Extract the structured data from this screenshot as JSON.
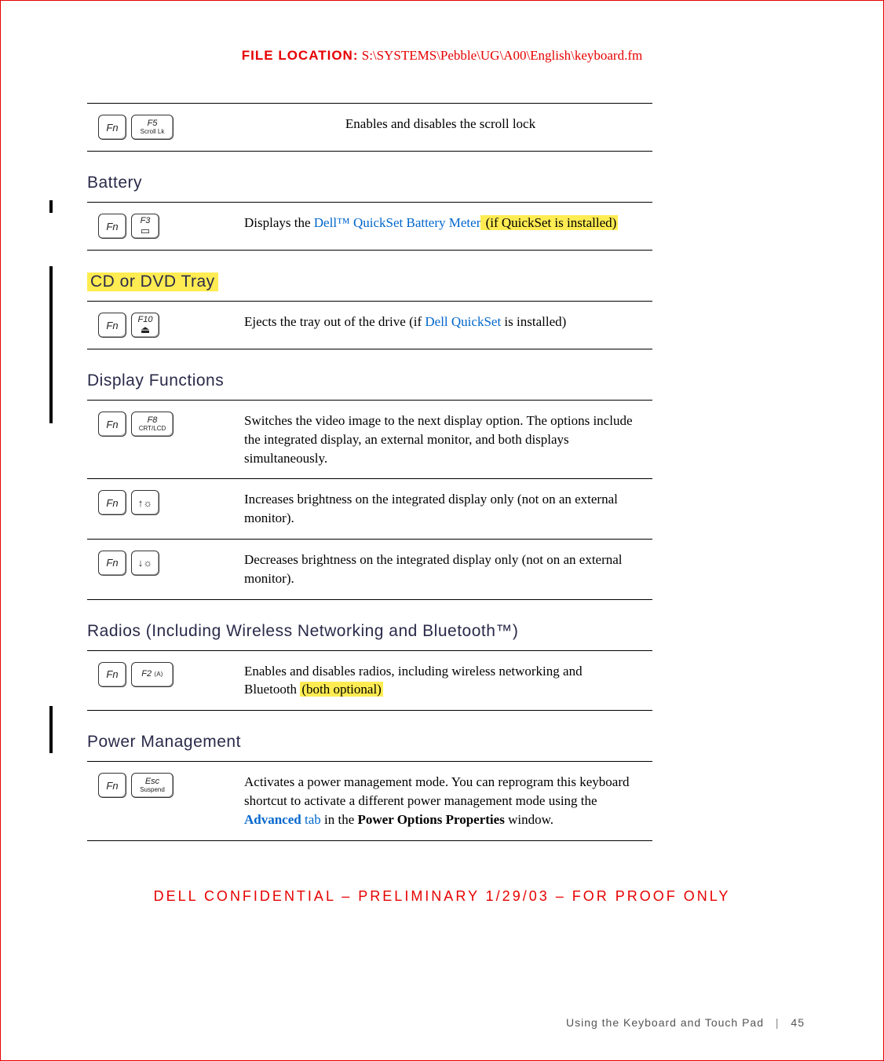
{
  "file_location": {
    "label": "FILE LOCATION:",
    "path": "S:\\SYSTEMS\\Pebble\\UG\\A00\\English\\keyboard.fm"
  },
  "sections": {
    "scroll": {
      "key1": "Fn",
      "key2_top": "F5",
      "key2_bot": "Scroll Lk",
      "desc": "Enables and disables the scroll lock"
    },
    "battery": {
      "heading": "Battery",
      "key1": "Fn",
      "key2_top": "F3",
      "desc_pre": "Displays the ",
      "desc_link": "Dell™ QuickSet Battery Meter",
      "desc_hl": " (if QuickSet is installed)"
    },
    "cd": {
      "heading": "CD or DVD Tray",
      "key1": "Fn",
      "key2_top": "F10",
      "desc_pre": "Ejects the tray out of the drive (if ",
      "desc_link": "Dell QuickSet",
      "desc_post": " is installed)"
    },
    "display": {
      "heading": "Display Functions",
      "r1_key1": "Fn",
      "r1_key2_top": "F8",
      "r1_key2_bot": "CRT/LCD",
      "r1_desc": "Switches the video image to the next display option. The options include the integrated display, an external monitor, and both displays simultaneously.",
      "r2_key1": "Fn",
      "r2_key2_icon": "↑☼",
      "r2_desc": "Increases brightness on the integrated display only (not on an external monitor).",
      "r3_key1": "Fn",
      "r3_key2_icon": "↓☼",
      "r3_desc": "Decreases brightness on the integrated display only (not on an external monitor)."
    },
    "radios": {
      "heading": "Radios (Including Wireless Networking and Bluetooth™)",
      "key1": "Fn",
      "key2_top": "F2",
      "key2_icon": "⟨A⟩",
      "desc_pre": "Enables and disables radios, including wireless networking and Bluetooth ",
      "desc_hl": "(both optional)"
    },
    "power": {
      "heading": "Power Management",
      "key1": "Fn",
      "key2_top": "Esc",
      "key2_bot": "Suspend",
      "desc_pre": "Activates a power management mode. You can reprogram this keyboard shortcut to activate a different power management mode using the ",
      "desc_link": "Advanced",
      "desc_link2": " tab",
      "desc_mid": " in the ",
      "desc_bold": "Power Options Properties",
      "desc_post": " window."
    }
  },
  "confidential": "DELL CONFIDENTIAL – PRELIMINARY 1/29/03 – FOR PROOF ONLY",
  "footer": {
    "section": "Using the Keyboard and Touch Pad",
    "page": "45"
  }
}
